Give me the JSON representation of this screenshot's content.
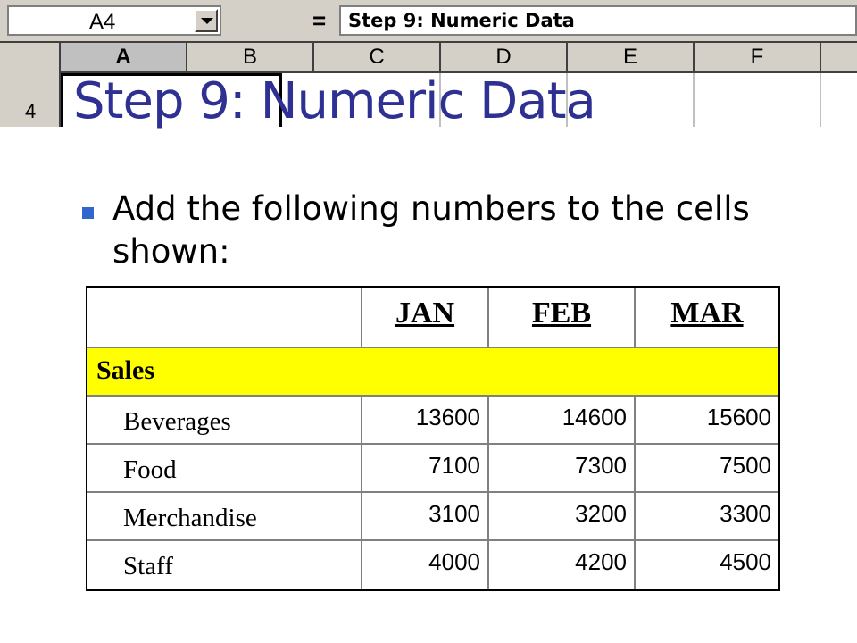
{
  "excel": {
    "name_box": "A4",
    "equals": "=",
    "formula": "Step 9: Numeric Data",
    "columns": [
      "A",
      "B",
      "C",
      "D",
      "E",
      "F"
    ],
    "selected_column": "A",
    "row_number": "4"
  },
  "slide": {
    "title": "Step 9: Numeric Data",
    "bullet": "Add the following numbers to the cells shown:"
  },
  "table": {
    "months": [
      "JAN",
      "FEB",
      "MAR"
    ],
    "section": "Sales",
    "rows": [
      {
        "label": "Beverages",
        "values": [
          "13600",
          "14600",
          "15600"
        ]
      },
      {
        "label": "Food",
        "values": [
          "7100",
          "7300",
          "7500"
        ]
      },
      {
        "label": "Merchandise",
        "values": [
          "3100",
          "3200",
          "3300"
        ]
      },
      {
        "label": "Staff",
        "values": [
          "4000",
          "4200",
          "4500"
        ]
      }
    ]
  },
  "colors": {
    "title": "#2e3192",
    "bullet": "#3366cc",
    "section_highlight": "#ffff00",
    "toolbar": "#d4d0c8"
  }
}
